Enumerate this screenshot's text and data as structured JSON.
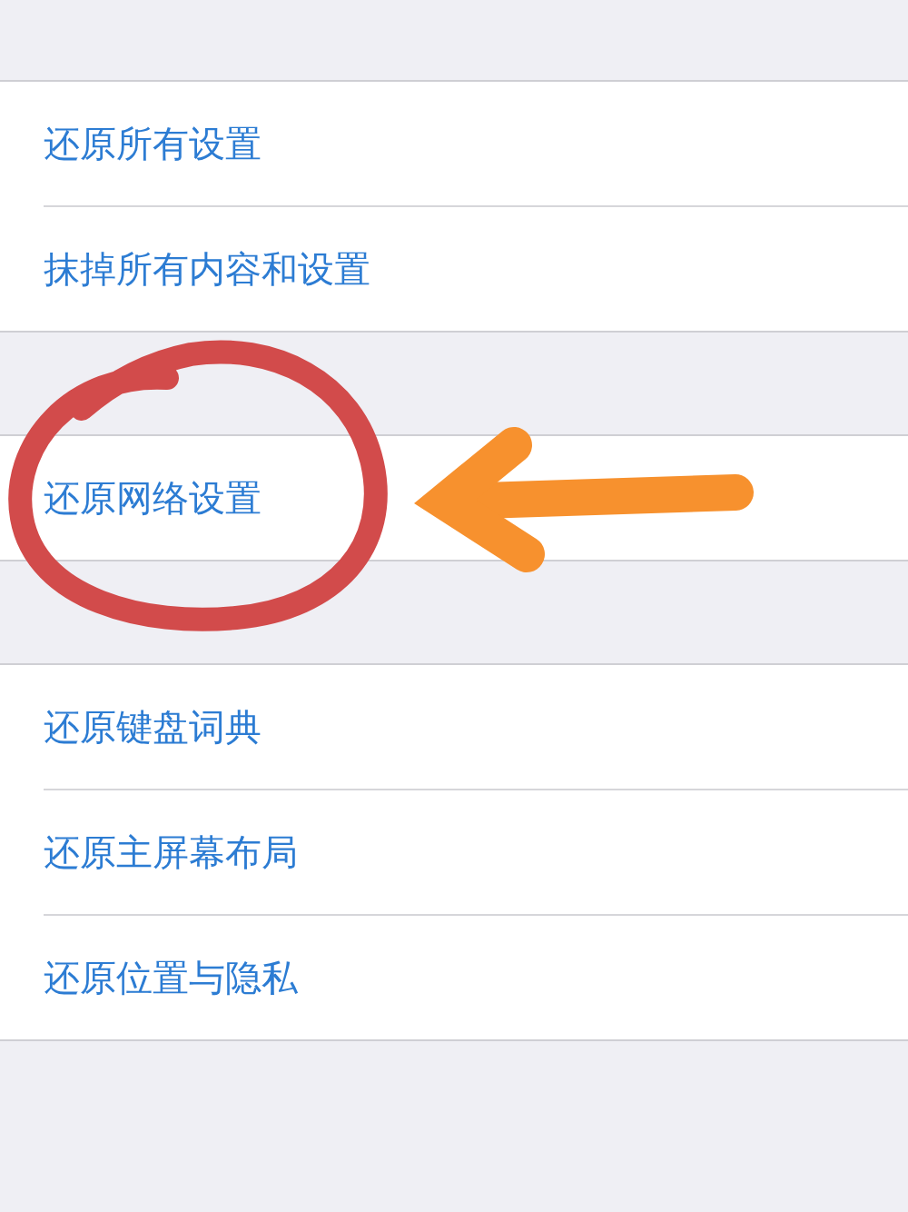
{
  "groups": [
    {
      "items": [
        {
          "label": "还原所有设置"
        },
        {
          "label": "抹掉所有内容和设置"
        }
      ]
    },
    {
      "items": [
        {
          "label": "还原网络设置"
        }
      ]
    },
    {
      "items": [
        {
          "label": "还原键盘词典"
        },
        {
          "label": "还原主屏幕布局"
        },
        {
          "label": "还原位置与隐私"
        }
      ]
    }
  ]
}
